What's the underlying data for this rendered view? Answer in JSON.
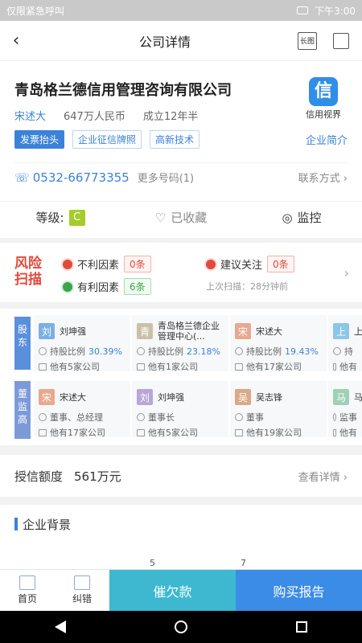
{
  "status_bar": {
    "left_text": "仅限紧急呼叫",
    "time": "下午3:00"
  },
  "header": {
    "title": "公司详情",
    "long_image_label": "长图"
  },
  "company": {
    "name": "青岛格兰德信用管理咨询有限公司",
    "legal_person": "宋述大",
    "capital": "647万人民币",
    "established": "成立12年半",
    "tags": [
      "发票抬头",
      "企业征信牌照",
      "高新技术"
    ],
    "logo_text": "信用视界",
    "intro_link": "企业简介",
    "phone": "0532-66773355",
    "more_numbers": "更多号码(1)",
    "contact_link": "联系方式",
    "grade_label": "等级:",
    "grade_value": "C",
    "favorite_label": "已收藏",
    "monitor_label": "监控"
  },
  "risk_scan": {
    "logo_line1": "风险",
    "logo_line2": "扫描",
    "unfavorable_label": "不利因素",
    "unfavorable_count": "0条",
    "suggest_label": "建议关注",
    "suggest_count": "0条",
    "favorable_label": "有利因素",
    "favorable_count": "6条",
    "last_scan": "上次扫描：28分钟前"
  },
  "shareholders": {
    "section_label": "股东",
    "items": [
      {
        "avatar": "刘",
        "name": "刘坤强",
        "ratio_label": "持股比例",
        "ratio": "30.39%",
        "companies": "他有5家公司"
      },
      {
        "avatar": "青",
        "name": "青岛格兰德企业管理中心(...",
        "ratio_label": "持股比例",
        "ratio": "23.18%",
        "companies": "他有1家公司"
      },
      {
        "avatar": "宋",
        "name": "宋述大",
        "ratio_label": "持股比例",
        "ratio": "19.43%",
        "companies": "他有17家公司"
      },
      {
        "avatar": "上",
        "name": "上",
        "ratio_label": "持",
        "ratio": "",
        "companies": "他有"
      }
    ]
  },
  "executives": {
    "section_label": "董监高",
    "items": [
      {
        "avatar": "宋",
        "name": "宋述大",
        "role": "董事、总经理",
        "companies": "他有17家公司"
      },
      {
        "avatar": "刘",
        "name": "刘坤强",
        "role": "董事长",
        "companies": "他有5家公司"
      },
      {
        "avatar": "吴",
        "name": "吴志锋",
        "role": "董事",
        "companies": "他有19家公司"
      },
      {
        "avatar": "马",
        "name": "马",
        "role": "监事",
        "companies": "他有"
      }
    ]
  },
  "credit": {
    "label": "授信额度",
    "value": "561万元",
    "detail_link": "查看详情"
  },
  "background": {
    "title": "企业背景",
    "num1": "5",
    "num2": "7"
  },
  "tabbar": {
    "home": "首页",
    "correct": "纠错",
    "urge": "催欠款",
    "buy": "购买报告"
  },
  "colors": {
    "accent": "#3b82d8",
    "risk_red": "#e24a3b",
    "positive_green": "#3aa54b",
    "urge_button": "#3db8d0",
    "buy_button": "#3b8ce6"
  }
}
